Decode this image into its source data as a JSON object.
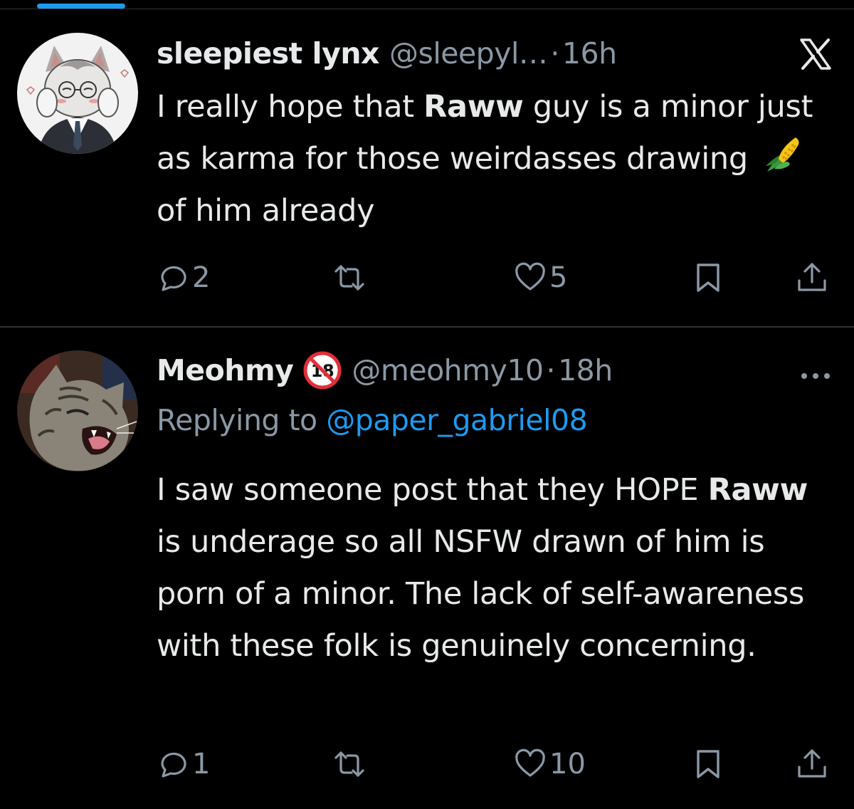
{
  "tweets": [
    {
      "name": "sleepiest lynx",
      "handle": "@sleepyl…",
      "separator": "·",
      "time": "16h",
      "body": {
        "part1": "I really hope that ",
        "bold": "Raww",
        "part2": " guy is a minor just as karma for those weirdasses drawing ",
        "emoji": "corn-emoji",
        "part3": " of him already"
      },
      "actions": {
        "replies": "2",
        "retweets": "",
        "likes": "5"
      },
      "corner_icon": "x-logo-icon"
    },
    {
      "name": "Meohmy",
      "badge": "18",
      "handle": "@meohmy10",
      "separator": "·",
      "time": "18h",
      "replying_to_label": "Replying to ",
      "replying_to_handle": "@paper_gabriel08",
      "body": {
        "part1": "I saw someone post that they HOPE ",
        "bold": "Raww",
        "part2": " is underage so all NSFW drawn of him is porn of a minor. The lack of self-awareness with these folk is genuinely concerning."
      },
      "actions": {
        "replies": "1",
        "retweets": "",
        "likes": "10"
      },
      "corner_icon": "more-icon"
    }
  ],
  "colors": {
    "background": "#000000",
    "text": "#e7e9ea",
    "secondary": "#8b98a5",
    "accent": "#1d9bf0",
    "divider": "#2f3336"
  }
}
